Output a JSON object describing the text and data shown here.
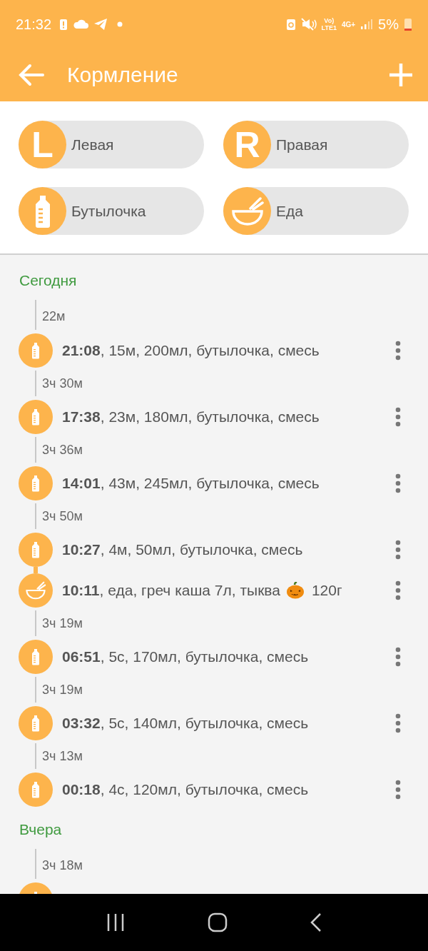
{
  "status_bar": {
    "time": "21:32",
    "volte_top": "Vo)",
    "volte_bottom": "LTE1",
    "network": "4G+",
    "battery": "5%"
  },
  "app_bar": {
    "title": "Кормление"
  },
  "quick_add": [
    {
      "kind": "letter",
      "letter": "L",
      "label": "Левая"
    },
    {
      "kind": "letter",
      "letter": "R",
      "label": "Правая"
    },
    {
      "kind": "bottle",
      "label": "Бутылочка"
    },
    {
      "kind": "food",
      "label": "Еда"
    }
  ],
  "sections": [
    {
      "title": "Сегодня",
      "entries": [
        {
          "gap": "22м",
          "kind": "bottle",
          "text": "**21:08**, 15м, 200мл, бутылочка, смесь"
        },
        {
          "gap": "3ч 30м",
          "kind": "bottle",
          "text": "**17:38**, 23м, 180мл, бутылочка, смесь"
        },
        {
          "gap": "3ч 36м",
          "kind": "bottle",
          "text": "**14:01**, 43м, 245мл, бутылочка, смесь"
        },
        {
          "gap": "3ч 50м",
          "kind": "bottle",
          "text": "**10:27**, 4м, 50мл, бутылочка, смесь"
        },
        {
          "kind": "food",
          "text": "**10:11**, еда, греч каша 7л, тыква",
          "tail": "120г"
        },
        {
          "gap": "3ч 19м",
          "kind": "bottle",
          "text": "**06:51**, 5с, 170мл, бутылочка, смесь"
        },
        {
          "gap": "3ч 19м",
          "kind": "bottle",
          "text": "**03:32**, 5с, 140мл, бутылочка, смесь"
        },
        {
          "gap": "3ч 13м",
          "kind": "bottle",
          "text": "**00:18**, 4с, 120мл, бутылочка, смесь"
        }
      ]
    },
    {
      "title": "Вчера",
      "entries": [
        {
          "gap": "3ч 18м",
          "kind": "bottle"
        }
      ]
    }
  ]
}
